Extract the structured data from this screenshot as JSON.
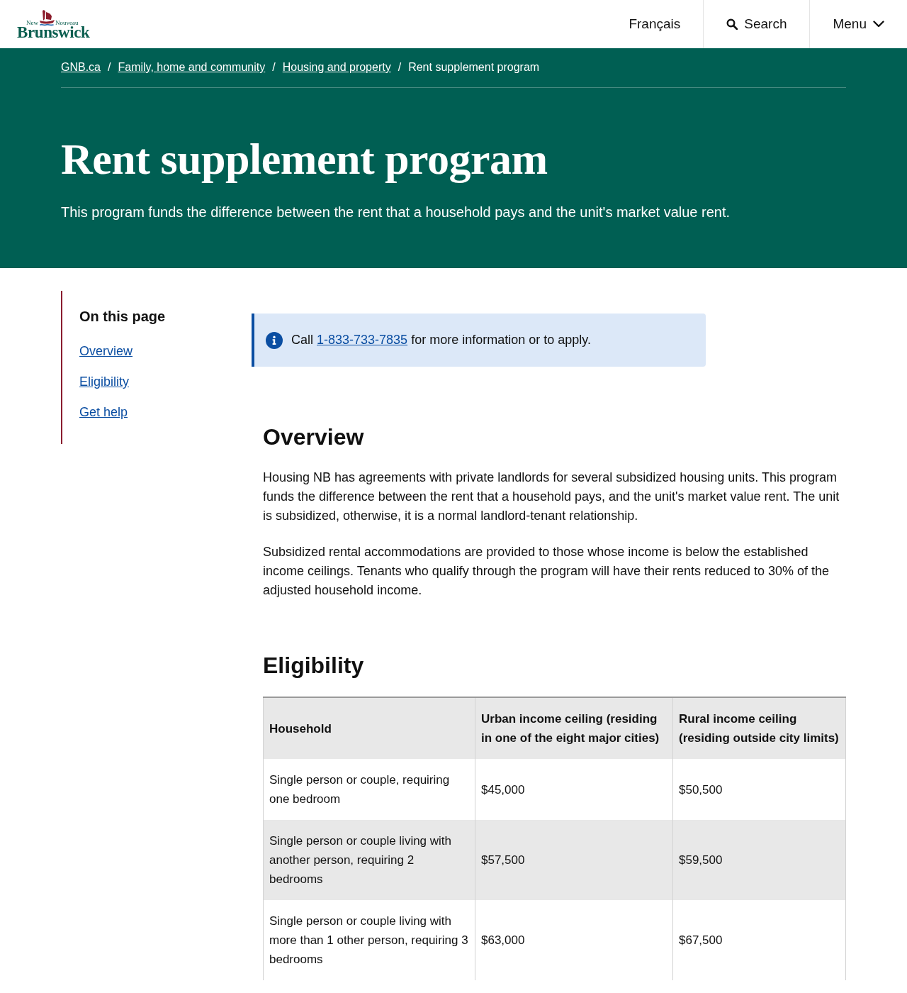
{
  "header": {
    "logo": {
      "word_left": "New",
      "word_right": "Nouveau",
      "name": "Brunswick"
    },
    "nav": [
      {
        "kind": "language",
        "label": "Français"
      },
      {
        "kind": "search",
        "label": "Search"
      },
      {
        "kind": "menu",
        "label": "Menu"
      }
    ]
  },
  "hero": {
    "breadcrumb": [
      {
        "label": "GNB.ca",
        "current": false
      },
      {
        "separator": "/",
        "label": "Family, home and community",
        "current": false
      },
      {
        "separator": "/",
        "label": "Housing and property",
        "current": false
      },
      {
        "separator": "/",
        "label": "Rent supplement program",
        "current": true
      }
    ],
    "title": "Rent supplement program",
    "lead": "This program funds the difference between the rent that a household pays and the unit's market value rent."
  },
  "toc": {
    "title": "On this page",
    "links": [
      "Overview",
      "Eligibility",
      "Get help"
    ]
  },
  "notice": {
    "before": "Call",
    "phone": "1-833-733-7835",
    "after": "for more information or to apply."
  },
  "sections": [
    {
      "heading": "Overview",
      "paragraphs": [
        "Housing NB has agreements with private landlords for several subsidized housing units. This program funds the difference between the rent that a household pays, and the unit's market value rent. The unit is subsidized, otherwise, it is a normal landlord-tenant relationship.",
        "Subsidized rental accommodations are provided to those whose income is below the established income ceilings. Tenants who qualify through the program will have their rents reduced to 30% of the adjusted household income."
      ]
    },
    {
      "heading": "Eligibility",
      "table": {
        "columns": [
          "Household",
          "Urban income ceiling (residing in one of the eight major cities)",
          "Rural income ceiling (residing outside city limits)"
        ],
        "rows": [
          [
            "Single person or couple, requiring one bedroom",
            "$45,000",
            "$50,500"
          ],
          [
            "Single person or couple living with another person, requiring 2 bedrooms",
            "$57,500",
            "$59,500"
          ],
          [
            "Single person or couple living with more than 1 other person, requiring 3 bedrooms",
            "$63,000",
            "$67,500"
          ]
        ]
      }
    }
  ]
}
